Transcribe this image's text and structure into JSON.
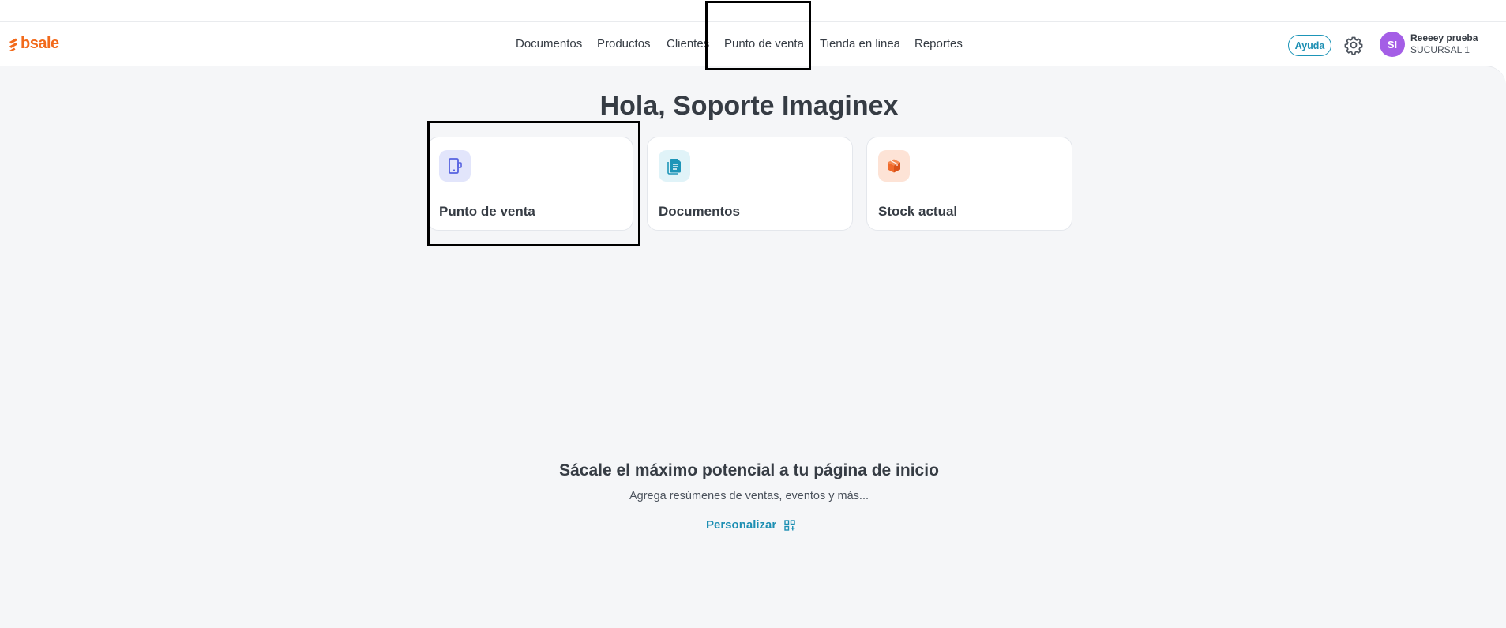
{
  "brand": {
    "name": "bsale",
    "accent": "#f26a1b"
  },
  "nav": {
    "items": [
      {
        "label": "Documentos"
      },
      {
        "label": "Productos"
      },
      {
        "label": "Clientes"
      },
      {
        "label": "Punto de venta"
      },
      {
        "label": "Tienda en linea"
      },
      {
        "label": "Reportes"
      }
    ]
  },
  "header": {
    "help_label": "Ayuda",
    "settings_icon": "gear-icon",
    "user": {
      "initials": "SI",
      "name": "Reeeey prueba",
      "branch": "SUCURSAL 1"
    }
  },
  "main": {
    "greeting": "Hola, Soporte Imaginex",
    "cards": [
      {
        "label": "Punto de venta",
        "icon": "point-of-sale-icon",
        "icon_color": "#5662e0",
        "icon_bg": "#e2e5fb"
      },
      {
        "label": "Documentos",
        "icon": "document-icon",
        "icon_color": "#1d95b8",
        "icon_bg": "#e0f3f8"
      },
      {
        "label": "Stock actual",
        "icon": "box-icon",
        "icon_color": "#f06b2c",
        "icon_bg": "#fde3d6"
      }
    ],
    "promo": {
      "title": "Sácale el máximo potencial a tu página de inicio",
      "subtitle": "Agrega resúmenes de ventas, eventos y más...",
      "customize_label": "Personalizar",
      "customize_icon": "widget-grid-icon"
    }
  }
}
